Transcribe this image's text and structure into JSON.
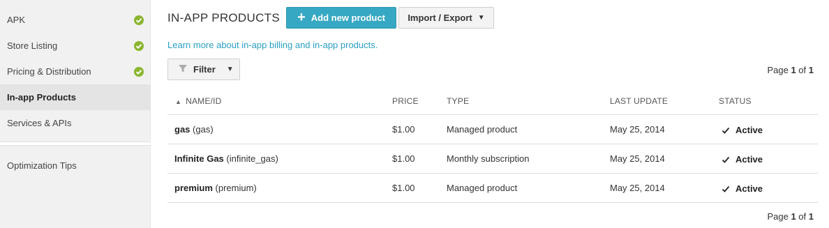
{
  "sidebar": {
    "items": [
      {
        "label": "APK",
        "checked": true
      },
      {
        "label": "Store Listing",
        "checked": true
      },
      {
        "label": "Pricing & Distribution",
        "checked": true
      },
      {
        "label": "In-app Products",
        "checked": false,
        "active": true
      },
      {
        "label": "Services & APIs",
        "checked": false
      }
    ],
    "secondary": [
      {
        "label": "Optimization Tips"
      }
    ],
    "check_color": "#8ab530"
  },
  "header": {
    "title": "IN-APP PRODUCTS",
    "add_button": "Add new product",
    "import_export_button": "Import / Export"
  },
  "learn_link": "Learn more about in-app billing and in-app products.",
  "filter_button": "Filter",
  "pager": {
    "prefix": "Page",
    "current": "1",
    "of": "of",
    "total": "1"
  },
  "table": {
    "columns": [
      "NAME/ID",
      "PRICE",
      "TYPE",
      "LAST UPDATE",
      "STATUS"
    ],
    "rows": [
      {
        "name": "gas",
        "id": "(gas)",
        "price": "$1.00",
        "type": "Managed product",
        "updated": "May 25, 2014",
        "status": "Active"
      },
      {
        "name": "Infinite Gas",
        "id": "(infinite_gas)",
        "price": "$1.00",
        "type": "Monthly subscription",
        "updated": "May 25, 2014",
        "status": "Active"
      },
      {
        "name": "premium",
        "id": "(premium)",
        "price": "$1.00",
        "type": "Managed product",
        "updated": "May 25, 2014",
        "status": "Active"
      }
    ]
  },
  "colors": {
    "accent": "#37a8c4",
    "link": "#2a9fc4"
  }
}
